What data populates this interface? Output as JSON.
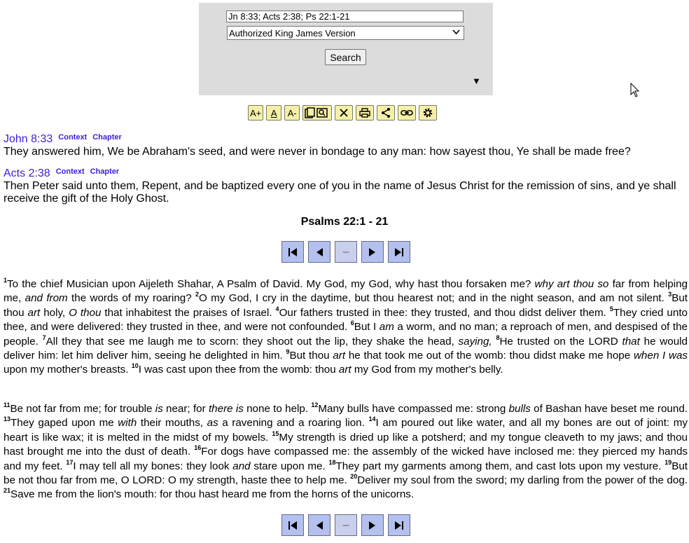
{
  "search": {
    "query": "Jn 8:33; Acts 2:38; Ps 22:1-21",
    "version_selected": "Authorized King James Version",
    "button_label": "Search",
    "toggle_glyph": "▼"
  },
  "toolbar": {
    "font_increase": "A+",
    "font_default": "A",
    "font_decrease": "A-",
    "icons": [
      "copy-icon",
      "close-icon",
      "print-icon",
      "share-icon",
      "link-icon",
      "gear-icon"
    ]
  },
  "results": {
    "john": {
      "ref": "John 8:33",
      "context_label": "Context",
      "chapter_label": "Chapter",
      "text": "They answered him, We be Abraham's seed, and were never in bondage to any man: how sayest thou, Ye shall be made free?"
    },
    "acts": {
      "ref": "Acts 2:38",
      "context_label": "Context",
      "chapter_label": "Chapter",
      "text": "Then Peter said unto them, Repent, and be baptized every one of you in the name of Jesus Christ for the remission of sins, and ye shall receive the gift of the Holy Ghost."
    }
  },
  "psalm": {
    "title": "Psalms 22:1 - 21",
    "nav_middle": "–",
    "verses": {
      "v1a": "To the chief Musician upon Aijeleth Shahar, A Psalm of David. My God, my God, why hast thou forsaken me? ",
      "v1i": "why art thou so",
      "v1b": " far from helping me, ",
      "v1i2": "and from",
      "v1c": " the words of my roaring? ",
      "v2": "O my God, I cry in the daytime, but thou hearest not; and in the night season, and am not silent. ",
      "v3a": "But thou ",
      "v3i": "art",
      "v3b": " holy, ",
      "v3i2": "O thou",
      "v3c": " that inhabitest the praises of Israel. ",
      "v4": "Our fathers trusted in thee: they trusted, and thou didst deliver them. ",
      "v5": "They cried unto thee, and were delivered: they trusted in thee, and were not confounded. ",
      "v6a": "But I ",
      "v6i": "am",
      "v6b": " a worm, and no man; a reproach of men, and despised of the people. ",
      "v7a": "All they that see me laugh me to scorn: they shoot out the lip, they shake the head, ",
      "v7i": "saying,",
      "v7b": " ",
      "v8a": "He trusted on the LORD ",
      "v8i": "that",
      "v8b": " he would deliver him: let him deliver him, seeing he delighted in him. ",
      "v9a": "But thou ",
      "v9i": "art",
      "v9b": " he that took me out of the womb: thou didst make me hope ",
      "v9i2": "when I was",
      "v9c": " upon my mother's breasts. ",
      "v10a": "I was cast upon thee from the womb: thou ",
      "v10i": "art",
      "v10b": " my God from my mother's belly.",
      "v11a": "Be not far from me; for trouble ",
      "v11i": "is",
      "v11b": " near; for ",
      "v11i2": "there is",
      "v11c": " none to help. ",
      "v12a": "Many bulls have compassed me: strong ",
      "v12i": "bulls",
      "v12b": " of Bashan have beset me round. ",
      "v13a": "They gaped upon me ",
      "v13i": "with",
      "v13b": " their mouths, ",
      "v13i2": "as",
      "v13c": " a ravening and a roaring lion. ",
      "v14": "I am poured out like water, and all my bones are out of joint: my heart is like wax; it is melted in the midst of my bowels. ",
      "v15": "My strength is dried up like a potsherd; and my tongue cleaveth to my jaws; and thou hast brought me into the dust of death. ",
      "v16": "For dogs have compassed me: the assembly of the wicked have inclosed me: they pierced my hands and my feet. ",
      "v17a": "I may tell all my bones: they look ",
      "v17i": "and",
      "v17b": " stare upon me. ",
      "v18": "They part my garments among them, and cast lots upon my vesture. ",
      "v19": "But be not thou far from me, O LORD: O my strength, haste thee to help me. ",
      "v20": "Deliver my soul from the sword; my darling from the power of the dog. ",
      "v21": "Save me from the lion's mouth: for thou hast heard me from the horns of the unicorns."
    },
    "numbers": [
      "1",
      "2",
      "3",
      "4",
      "5",
      "6",
      "7",
      "8",
      "9",
      "10",
      "11",
      "12",
      "13",
      "14",
      "15",
      "16",
      "17",
      "18",
      "19",
      "20",
      "21"
    ]
  }
}
